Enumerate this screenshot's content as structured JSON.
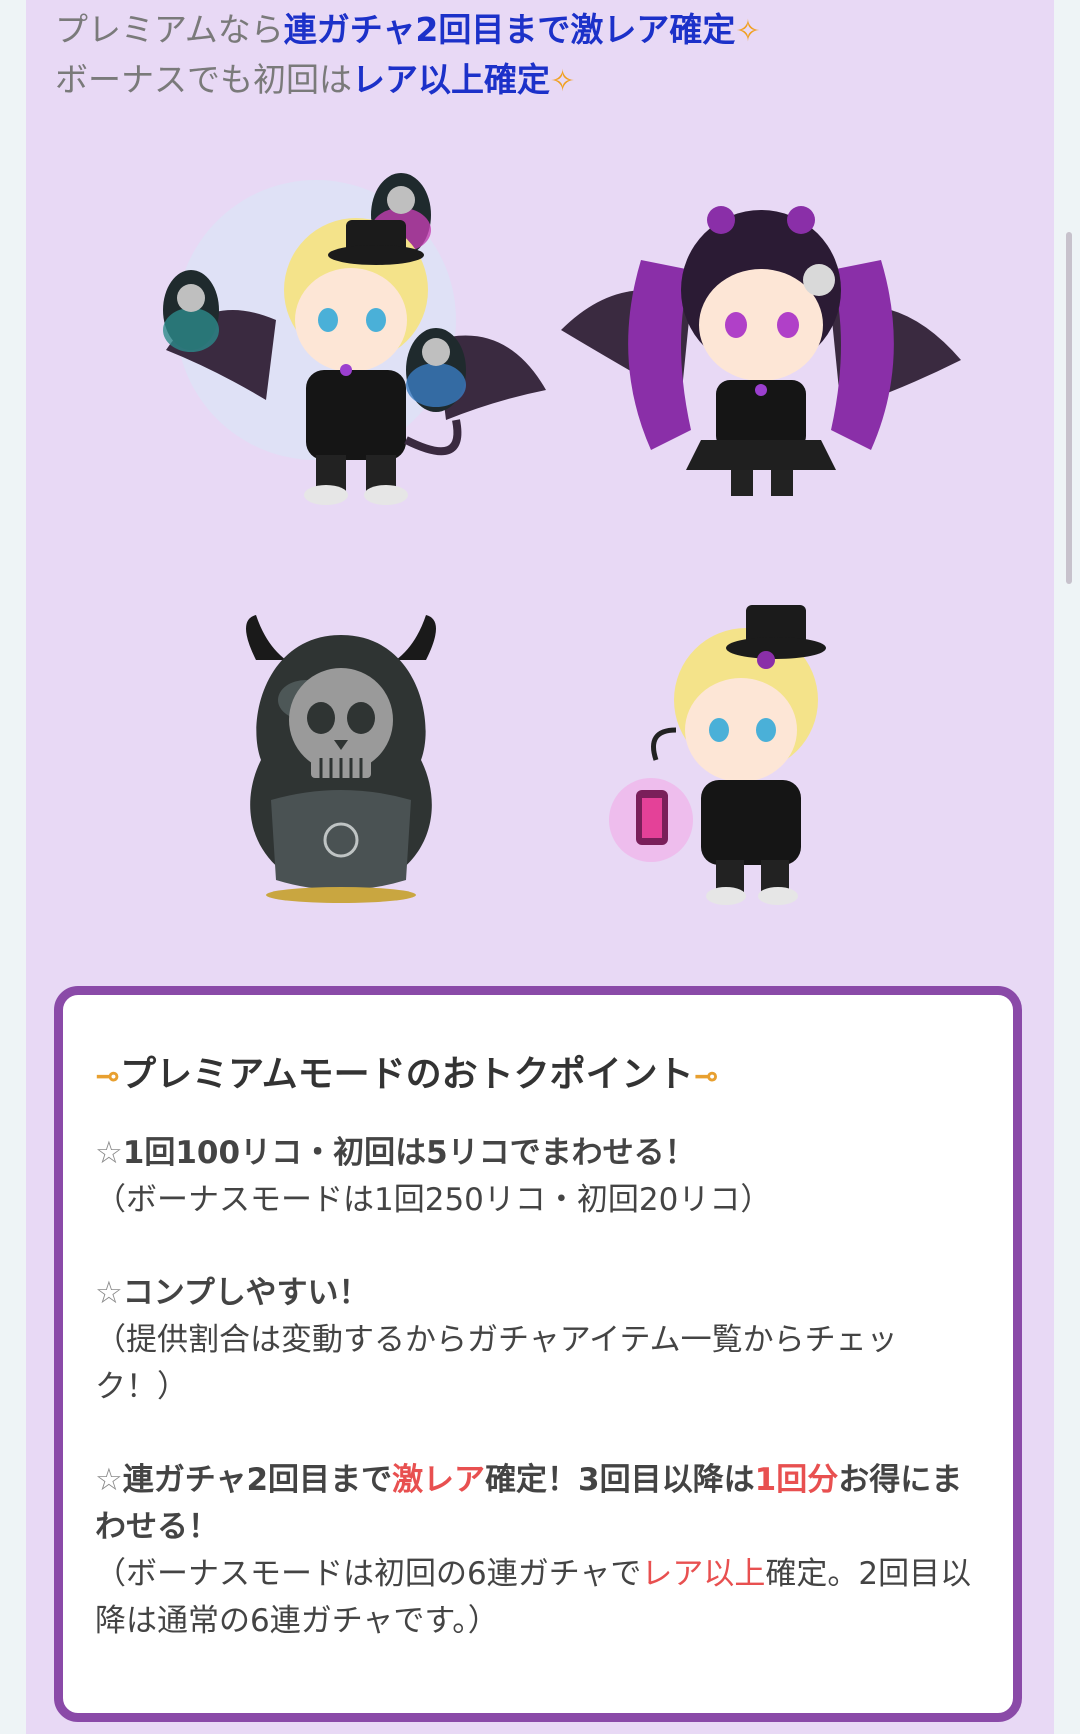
{
  "intro": {
    "line1_prefix": "プレミアムなら",
    "line1_highlight": "連ガチャ2回目まで激レア確定",
    "line2_prefix": "ボーナスでも初回は",
    "line2_highlight": "レア以上確定",
    "sparkle": "✧"
  },
  "images": [
    {
      "name": "devil-boy-avatar-with-dolls"
    },
    {
      "name": "devil-girl-avatar"
    },
    {
      "name": "skull-matryoshka-doll"
    },
    {
      "name": "boy-avatar-with-lantern"
    }
  ],
  "points": {
    "title": "プレミアムモードのおトクポイント",
    "halo": "⊸",
    "star": "☆",
    "p1_main": "1回100リコ・初回は5リコでまわせる！",
    "p1_sub": "（ボーナスモードは1回250リコ・初回20リコ）",
    "p2_main": "コンプしやすい！",
    "p2_sub_1": "（提供割合は変動するからガチャアイテム一覧からチェッ",
    "p2_sub_2": "ク！）",
    "p3_a": "連ガチャ2回目まで",
    "p3_b": "激レア",
    "p3_c": "確定！3回目以降は",
    "p3_d": "1回分",
    "p3_e": "お得にま",
    "p3_f": "わせる！",
    "p3_sub_a": "（ボーナスモードは初回の6連ガチャで",
    "p3_sub_b": "レア以上",
    "p3_sub_c": "確定。2回目以",
    "p3_sub_d": "降は通常の6連ガチャです。）"
  },
  "colors": {
    "accent_blue": "#1c31c9",
    "accent_red": "#e85050",
    "frame_purple": "#8a4aa8",
    "background": "#e8d9f5"
  }
}
